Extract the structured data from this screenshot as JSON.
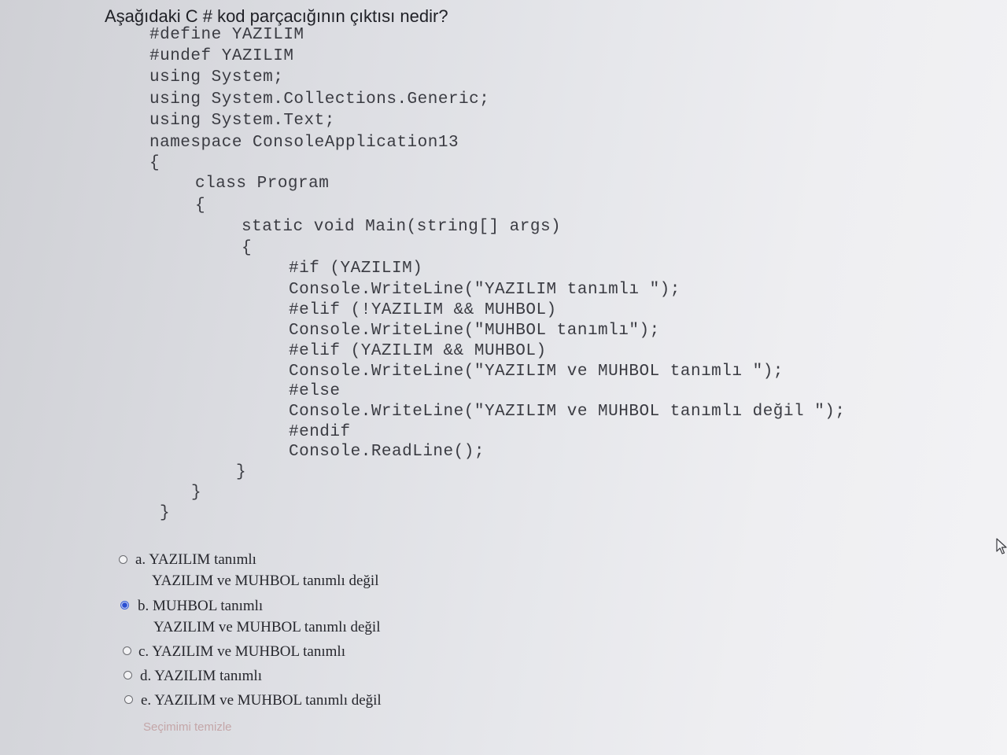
{
  "question": {
    "text": "Aşağıdaki C # kod parçacığının çıktısı nedir?"
  },
  "code_lines": [
    "#define YAZILIM",
    "#undef YAZILIM",
    "using System;",
    "using System.Collections.Generic;",
    "using System.Text;",
    "namespace ConsoleApplication13",
    "{",
    "class Program",
    "{",
    "static void Main(string[] args)",
    "{",
    "#if (YAZILIM)",
    "Console.WriteLine(\"YAZILIM tanımlı \");",
    "#elif (!YAZILIM && MUHBOL)",
    "Console.WriteLine(\"MUHBOL tanımlı\");",
    "#elif (YAZILIM && MUHBOL)",
    "Console.WriteLine(\"YAZILIM ve MUHBOL tanımlı \");",
    "#else",
    "Console.WriteLine(\"YAZILIM ve MUHBOL tanımlı değil \");",
    "#endif",
    "Console.ReadLine();",
    "}",
    "}",
    "}"
  ],
  "options": [
    {
      "label": "a. YAZILIM tanımlı",
      "continuation": "YAZILIM ve MUHBOL tanımlı değil",
      "selected": false
    },
    {
      "label": "b. MUHBOL tanımlı",
      "continuation": "YAZILIM ve MUHBOL tanımlı değil",
      "selected": true
    },
    {
      "label": "c. YAZILIM ve MUHBOL tanımlı",
      "selected": false
    },
    {
      "label": "d. YAZILIM tanımlı",
      "selected": false
    },
    {
      "label": "e. YAZILIM ve MUHBOL tanımlı değil",
      "selected": false
    }
  ],
  "clear_choice": {
    "label": "Seçimimi temizle"
  },
  "colors": {
    "selected_radio": "#2b4fd0",
    "clear_link": "#c4a6a8"
  },
  "icons": {
    "mouse_pointer": "arrow-cursor"
  }
}
